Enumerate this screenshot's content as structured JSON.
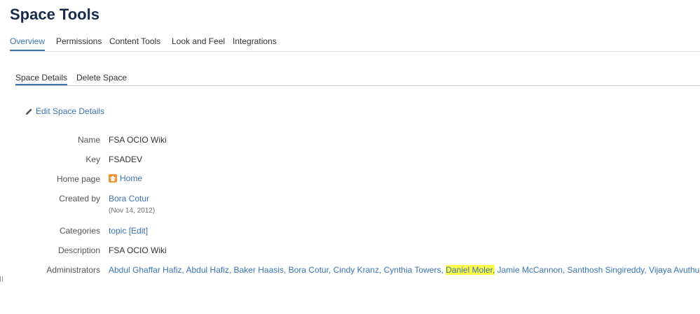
{
  "header": {
    "title": "Space Tools"
  },
  "primary_tabs": [
    {
      "label": "Overview",
      "active": true
    },
    {
      "label": "Permissions",
      "active": false
    },
    {
      "label": "Content Tools",
      "active": false
    },
    {
      "label": "Look and Feel",
      "active": false
    },
    {
      "label": "Integrations",
      "active": false
    }
  ],
  "secondary_tabs": [
    {
      "label": "Space Details",
      "active": true
    },
    {
      "label": "Delete Space",
      "active": false
    }
  ],
  "edit_link": {
    "label": "Edit Space Details",
    "icon": "pencil-icon"
  },
  "details": {
    "name": {
      "label": "Name",
      "value": "FSA OCIO Wiki"
    },
    "key": {
      "label": "Key",
      "value": "FSADEV"
    },
    "home_page": {
      "label": "Home page",
      "value": "Home",
      "icon": "home-icon"
    },
    "created_by": {
      "label": "Created by",
      "value": "Bora Cotur",
      "date": "(Nov 14, 2012)"
    },
    "categories": {
      "label": "Categories",
      "value": "topic",
      "edit": "[Edit]"
    },
    "description": {
      "label": "Description",
      "value": "FSA OCIO Wiki"
    },
    "administrators": {
      "label": "Administrators",
      "before": "Abdul Ghaffar Hafiz, Abdul Hafiz, Baker Haasis, Bora Cotur, Cindy Kranz, Cynthia Towers, ",
      "highlighted": "Daniel Moler,",
      "after": " Jamie McCannon, Santhosh Singireddy, Vijaya Avuthu"
    }
  },
  "colors": {
    "link": "#3b73af",
    "highlight": "#fbfb4a",
    "home_icon": "#f79232"
  }
}
